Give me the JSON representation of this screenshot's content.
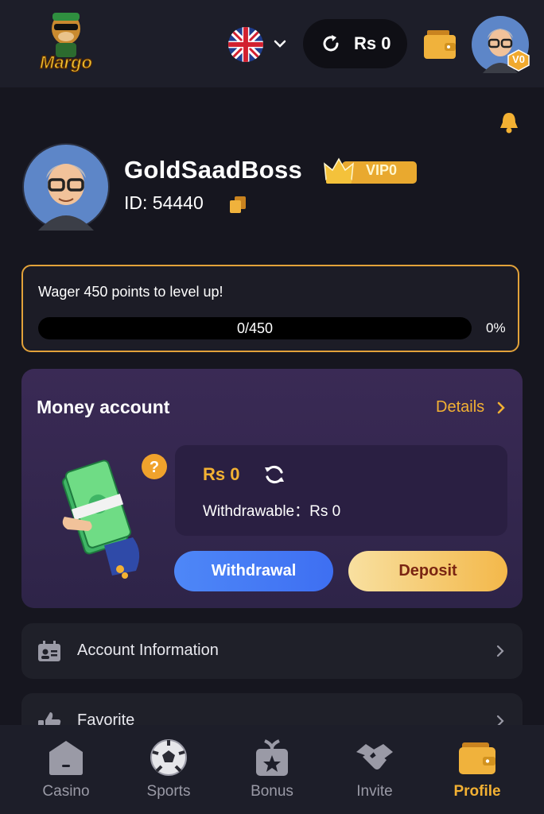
{
  "header": {
    "logo_text": "Margo",
    "language": "English",
    "balance": "Rs 0",
    "avatar_level": "V0"
  },
  "profile": {
    "username": "GoldSaadBoss",
    "vip_label": "VIP0",
    "id_label": "ID: 54440"
  },
  "wager": {
    "message": "Wager 450 points to level up!",
    "progress_text": "0/450",
    "percent_text": "0%",
    "progress_fraction": 0
  },
  "money_account": {
    "title": "Money account",
    "details_label": "Details",
    "balance": "Rs 0",
    "withdrawable": "Withdrawable：Rs 0",
    "withdraw_label": "Withdrawal",
    "deposit_label": "Deposit"
  },
  "menu": {
    "items": [
      {
        "label": "Account Information",
        "icon": "id-card-icon"
      },
      {
        "label": "Favorite",
        "icon": "thumbs-up-icon"
      }
    ]
  },
  "bottom_nav": {
    "items": [
      {
        "label": "Casino",
        "icon": "casino-icon"
      },
      {
        "label": "Sports",
        "icon": "soccer-ball-icon"
      },
      {
        "label": "Bonus",
        "icon": "gift-icon"
      },
      {
        "label": "Invite",
        "icon": "handshake-icon"
      },
      {
        "label": "Profile",
        "icon": "wallet-icon",
        "active": true
      }
    ]
  },
  "colors": {
    "accent": "#f3b133",
    "background": "#16161f",
    "panel": "#1f2029",
    "money_panel": "#3a2a55",
    "withdraw_button": "#4e87f7"
  }
}
